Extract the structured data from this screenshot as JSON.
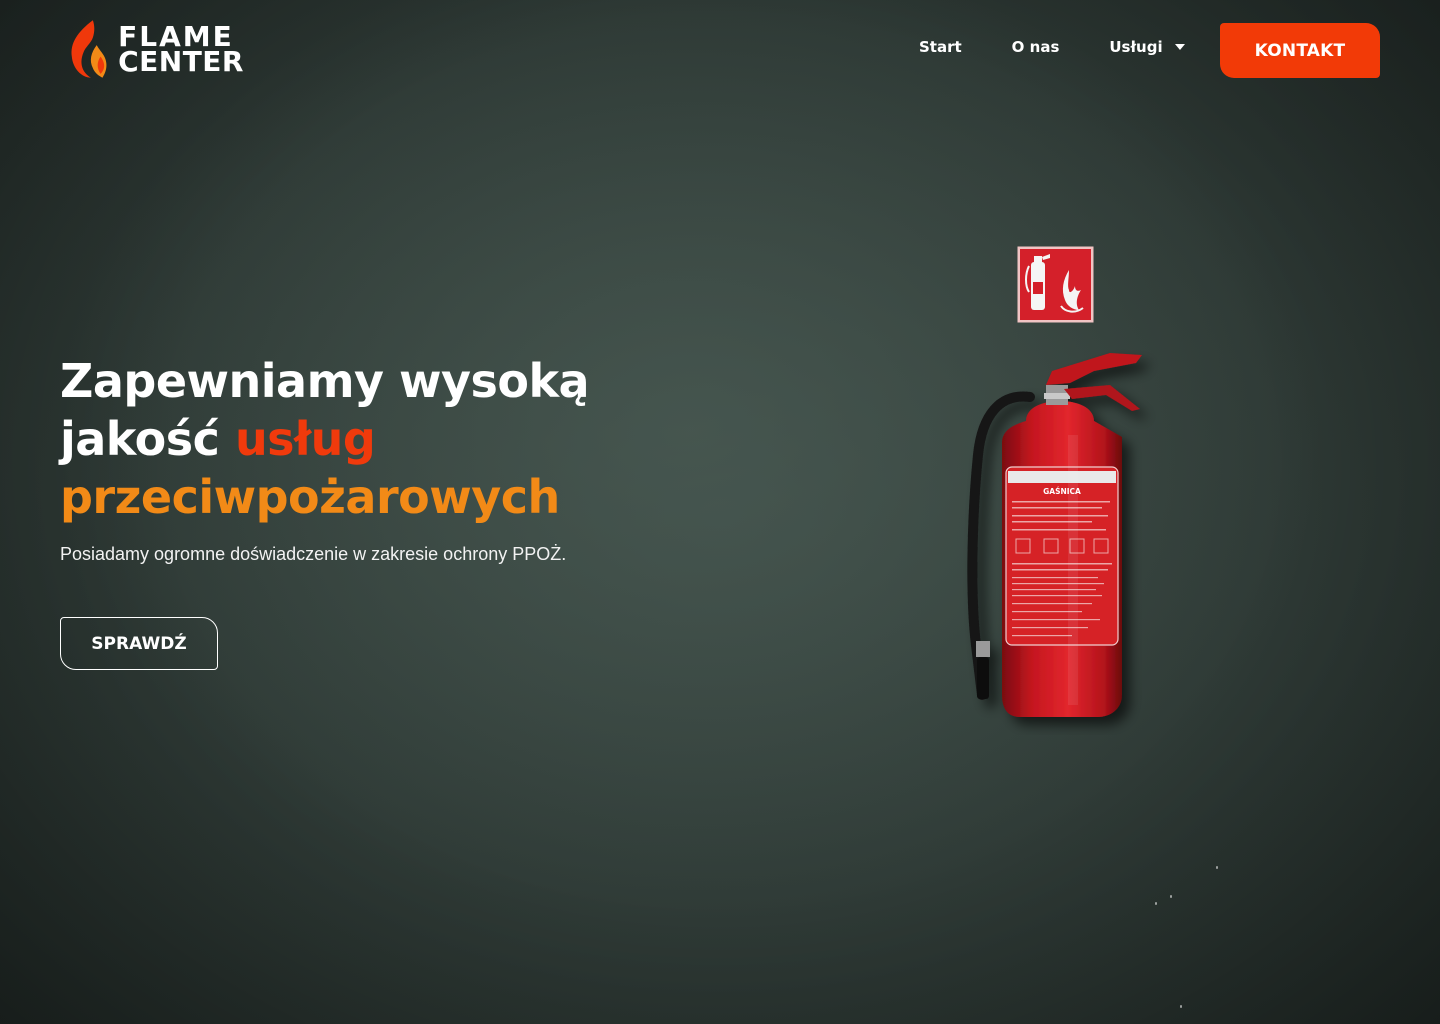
{
  "brand": {
    "line1": "FLAME",
    "line2": "CENTER"
  },
  "nav": {
    "start": "Start",
    "about": "O nas",
    "services": "Usługi",
    "contact": "KONTAKT"
  },
  "hero": {
    "title_part1": "Zapewniamy wysoką",
    "title_part2": "jakość ",
    "title_part3": "usług",
    "title_part4": "przeciwpożarowych",
    "subtitle": "Posiadamy ogromne doświadczenie w zakresie ochrony PPOŻ.",
    "cta": "SPRAWDŹ"
  },
  "extinguisher_label": {
    "heading": "GAŚNICA"
  },
  "colors": {
    "accent_red": "#f03a0c",
    "accent_orange": "#f28a17",
    "button_red": "#f23a07",
    "background": "#2f3b37"
  },
  "icons": {
    "logo": "flame-icon",
    "dropdown": "chevron-down-icon",
    "sign": "fire-extinguisher-sign-icon"
  }
}
